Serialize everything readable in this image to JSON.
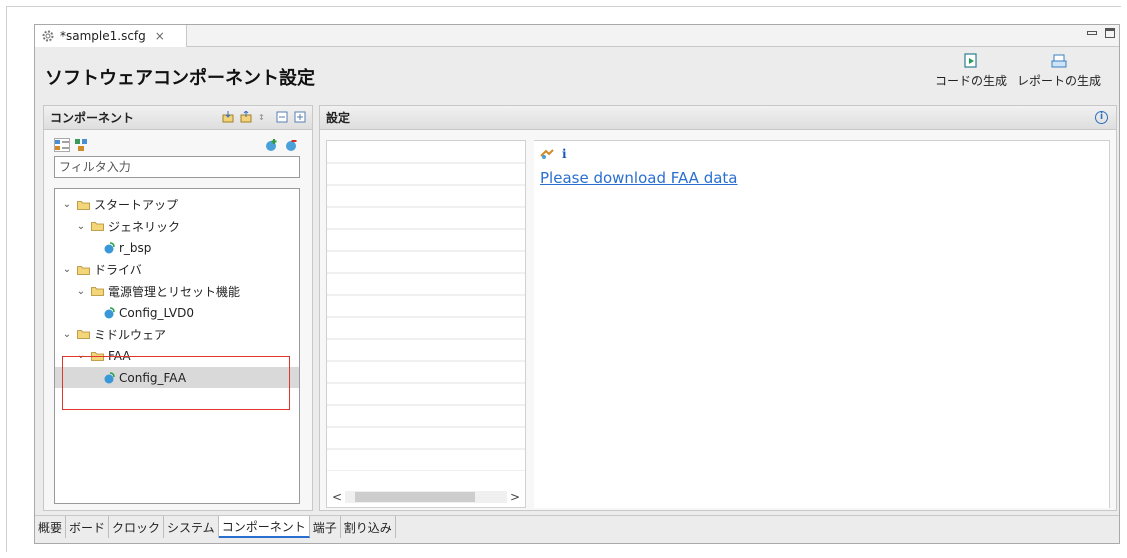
{
  "editor_tab": {
    "title": "*sample1.scfg",
    "close": "×"
  },
  "header": {
    "title": "ソフトウェアコンポーネント設定",
    "generate_code": "コードの生成",
    "generate_report": "レポートの生成"
  },
  "component_panel": {
    "title": "コンポーネント",
    "filter_placeholder": "フィルタ入力",
    "tree": [
      {
        "label": "スタートアップ",
        "level": 0,
        "kind": "folder",
        "expanded": true
      },
      {
        "label": "ジェネリック",
        "level": 1,
        "kind": "folder",
        "expanded": true
      },
      {
        "label": "r_bsp",
        "level": 2,
        "kind": "leaf"
      },
      {
        "label": "ドライバ",
        "level": 0,
        "kind": "folder",
        "expanded": true
      },
      {
        "label": "電源管理とリセット機能",
        "level": 1,
        "kind": "folder",
        "expanded": true
      },
      {
        "label": "Config_LVD0",
        "level": 2,
        "kind": "leaf"
      },
      {
        "label": "ミドルウェア",
        "level": 0,
        "kind": "folder",
        "expanded": true
      },
      {
        "label": "FAA",
        "level": 1,
        "kind": "folder",
        "expanded": true
      },
      {
        "label": "Config_FAA",
        "level": 2,
        "kind": "leaf",
        "selected": true
      }
    ]
  },
  "settings_panel": {
    "title": "設定",
    "info_letter": "i",
    "link_text": "Please download FAA data"
  },
  "bottom_tabs": [
    "概要",
    "ボード",
    "クロック",
    "システム",
    "コンポーネント",
    "端子",
    "割り込み"
  ],
  "active_bottom_tab": "コンポーネント",
  "colors": {
    "link": "#2a6fcf",
    "highlight_box": "#e0362c",
    "selected_row": "#d9d9d9"
  }
}
